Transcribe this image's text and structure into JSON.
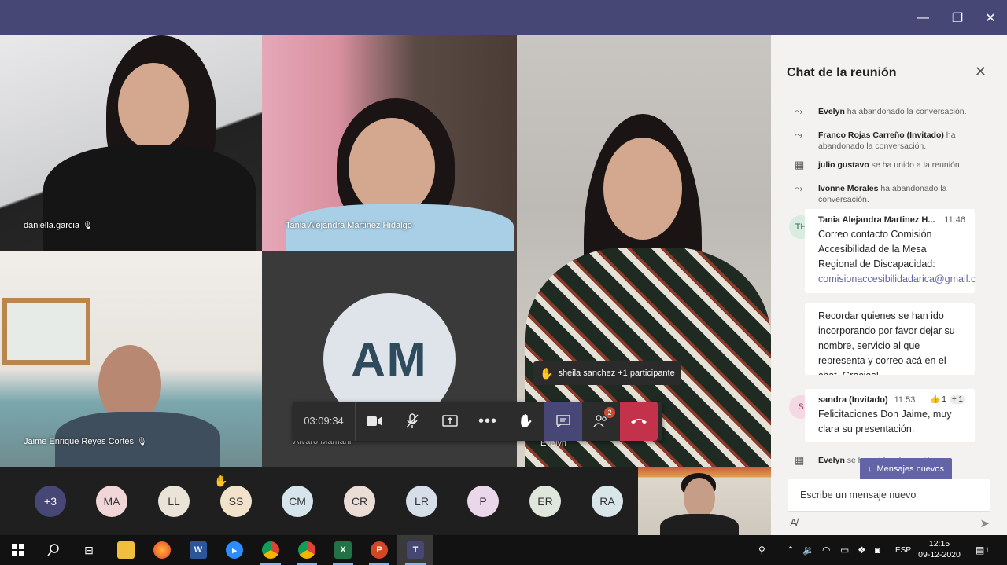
{
  "window": {
    "minimize": "—",
    "maximize": "❐",
    "close": "✕"
  },
  "tiles": [
    {
      "name": "daniella.garcia"
    },
    {
      "name": "Tania Alejandra Martinez Hidalgo"
    },
    {
      "name": "Evelyn"
    },
    {
      "name": "Jaime Enrique Reyes Cortes"
    },
    {
      "name": "Alvaro Mamani",
      "initials": "AM"
    }
  ],
  "raise_hand_banner": "sheila sanchez +1 participante",
  "toolbar": {
    "timer": "03:09:34",
    "participants_badge": "2"
  },
  "participants_strip": [
    {
      "initials": "+3",
      "color": "#464775",
      "text_color": "#ffffff"
    },
    {
      "initials": "MA",
      "color": "#f1d6d8",
      "text_color": "#333333"
    },
    {
      "initials": "LL",
      "color": "#e9e3d8",
      "text_color": "#333333"
    },
    {
      "initials": "SS",
      "color": "#f2e2cc",
      "text_color": "#333333",
      "hand_raised": true
    },
    {
      "initials": "CM",
      "color": "#d6e4ec",
      "text_color": "#333333"
    },
    {
      "initials": "CR",
      "color": "#ecdcd6",
      "text_color": "#333333"
    },
    {
      "initials": "LR",
      "color": "#d6deea",
      "text_color": "#333333"
    },
    {
      "initials": "P",
      "color": "#ead8ea",
      "text_color": "#333333"
    },
    {
      "initials": "ER",
      "color": "#dfe6dc",
      "text_color": "#333333"
    },
    {
      "initials": "RA",
      "color": "#d8e6ea",
      "text_color": "#333333"
    }
  ],
  "chat": {
    "title": "Chat de la reunión",
    "system_messages": [
      {
        "icon": "leave-icon",
        "name": "Evelyn",
        "text": " ha abandonado la conversación."
      },
      {
        "icon": "leave-icon",
        "name": "Franco Rojas Carreño (Invitado)",
        "text": " ha abandonado la conversación."
      },
      {
        "icon": "join-icon",
        "name": "julio gustavo",
        "text": " se ha unido a la reunión."
      },
      {
        "icon": "leave-icon",
        "name": "Ivonne Morales",
        "text": " ha abandonado la conversación."
      }
    ],
    "messages": [
      {
        "initials": "TH",
        "author": "Tania Alejandra Martinez H...",
        "time": "11:46",
        "text": "Correo contacto Comisión Accesibilidad de la Mesa Regional de Discapacidad: ",
        "link": "comisionaccesibilidadarica@gmail.com"
      },
      {
        "text": "Recordar quienes se han ido incorporando por favor dejar su nombre, servicio al que representa y correo acá en el chat. Gracias!"
      },
      {
        "initials": "S",
        "author": "sandra (Invitado)",
        "time": "11:53",
        "reaction": "👍 1",
        "reaction_extra": "+ 1",
        "text": "Felicitaciones Don Jaime, muy clara su presentación."
      }
    ],
    "last_system": {
      "name": "Evelyn",
      "text": " se ha unido a la reunión."
    },
    "new_messages_button": "Mensajes nuevos",
    "compose_placeholder": "Escribe un mensaje nuevo"
  },
  "taskbar": {
    "language": "ESP",
    "time": "12:15",
    "date": "09-12-2020",
    "notifications": "1"
  },
  "colors": {
    "teams_purple": "#464775",
    "hangup_red": "#c4314b",
    "accent": "#6264a7"
  }
}
